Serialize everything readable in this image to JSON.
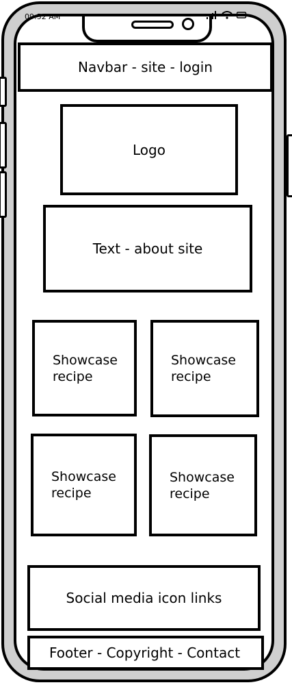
{
  "status_bar": {
    "time": "09:52 AM",
    "icons": [
      "signal-icon",
      "wifi-icon",
      "battery-icon"
    ]
  },
  "navbar": {
    "label": "Navbar - site - login"
  },
  "logo": {
    "label": "Logo"
  },
  "about": {
    "label": "Text - about site"
  },
  "showcase": [
    {
      "label": "Showcase recipe"
    },
    {
      "label": "Showcase recipe"
    },
    {
      "label": "Showcase recipe"
    },
    {
      "label": "Showcase recipe"
    }
  ],
  "social": {
    "label": "Social media icon links"
  },
  "footer": {
    "label": "Footer - Copyright - Contact"
  }
}
